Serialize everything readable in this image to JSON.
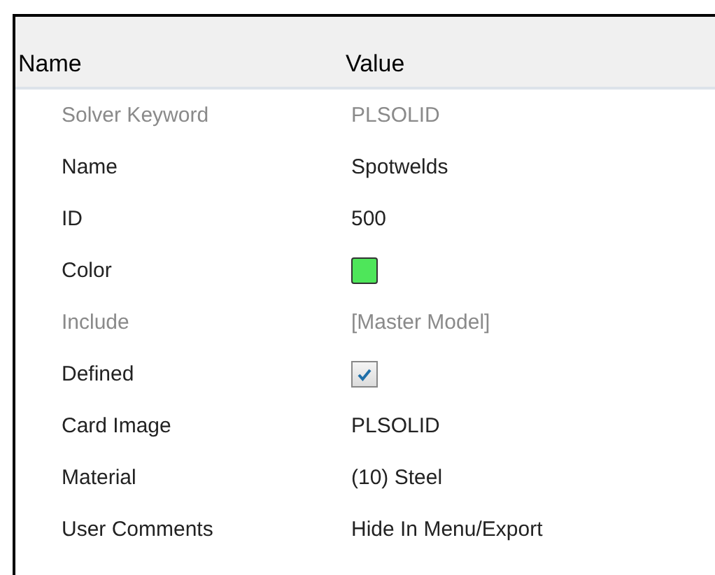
{
  "columns": [
    "Name",
    "Value"
  ],
  "rows": [
    {
      "name": "Solver Keyword",
      "kind": "text",
      "value": "PLSOLID",
      "disabled": true
    },
    {
      "name": "Name",
      "kind": "text",
      "value": "Spotwelds",
      "disabled": false
    },
    {
      "name": "ID",
      "kind": "text",
      "value": "500",
      "disabled": false
    },
    {
      "name": "Color",
      "kind": "color",
      "color": "#4ee65a",
      "disabled": false
    },
    {
      "name": "Include",
      "kind": "text",
      "value": "[Master Model]",
      "disabled": true
    },
    {
      "name": "Defined",
      "kind": "checkbox",
      "checked": true,
      "disabled": false
    },
    {
      "name": "Card Image",
      "kind": "text",
      "value": "PLSOLID",
      "disabled": false
    },
    {
      "name": "Material",
      "kind": "text",
      "value": "(10) Steel",
      "disabled": false
    },
    {
      "name": "User Comments",
      "kind": "text",
      "value": "Hide In Menu/Export",
      "disabled": false
    }
  ]
}
